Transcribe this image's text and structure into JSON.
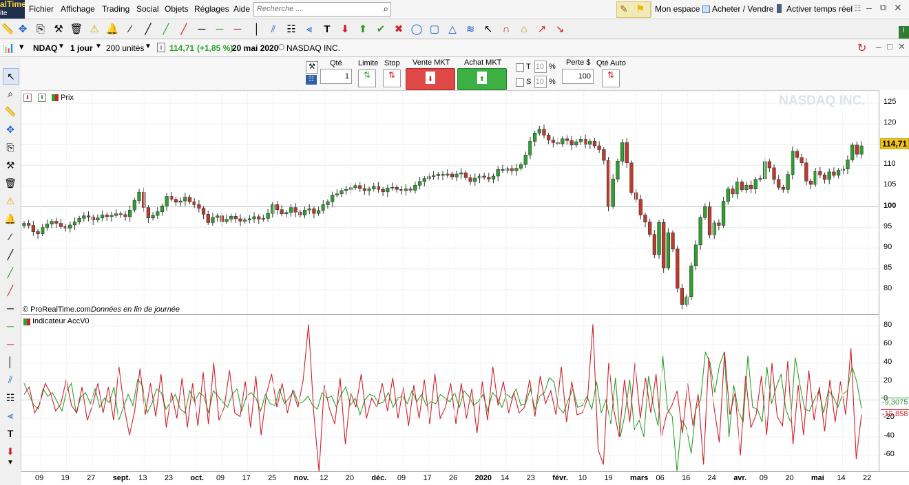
{
  "app": {
    "logo_line1": "alTime",
    "logo_line2": "ite"
  },
  "menu": [
    "Fichier",
    "Affichage",
    "Trading",
    "Social",
    "Objets",
    "Réglages",
    "Aide"
  ],
  "search": {
    "placeholder": "Recherche ..."
  },
  "top_buttons": {
    "mon_espace": "Mon espace",
    "acheter_vendre": "Acheter / Vendre",
    "activer": "Activer temps réel"
  },
  "window": {
    "ticker": "NDAQ",
    "interval": "1 jour",
    "units": "200 unités",
    "price": "114,71",
    "change": "(+1,85 %)",
    "date": "20 mai 2020",
    "name": "NASDAQ INC."
  },
  "order": {
    "qte_label": "Qté",
    "qte_value": "1",
    "limite_label": "Limite",
    "stop_label": "Stop",
    "vente_label": "Vente MKT",
    "achat_label": "Achat MKT",
    "t_label": "T",
    "s_label": "S",
    "t_value": "10",
    "s_value": "10",
    "pct": "%",
    "perte_label": "Perte $",
    "perte_value": "100",
    "qte_auto_label": "Qté Auto"
  },
  "price_panel": {
    "legend": "Prix",
    "watermark": "NASDAQ INC.",
    "footer_source": "© ProRealTime.com",
    "footer_note": "Données en fin de journée",
    "last_tag": "114,71"
  },
  "indicator_panel": {
    "legend": "Indicateur AccV0",
    "tag_green": "-9,3075",
    "tag_red": "-15,858"
  },
  "colors": {
    "up": "#2ea02e",
    "down": "#c0392b",
    "green_line": "#2ea02e",
    "red_line": "#d0202a",
    "last_tag_bg": "#f0c419"
  },
  "chart_data": [
    {
      "type": "candlestick",
      "title": "NASDAQ INC.",
      "ylim": [
        74,
        128
      ],
      "yticks": [
        80,
        85,
        90,
        95,
        100,
        105,
        110,
        115,
        120,
        125
      ],
      "x_tick_labels": [
        "09",
        "19",
        "27",
        "sept.",
        "13",
        "23",
        "oct.",
        "09",
        "17",
        "25",
        "nov.",
        "12",
        "20",
        "déc.",
        "09",
        "17",
        "26",
        "2020",
        "14",
        "23",
        "févr.",
        "10",
        "19",
        "mars",
        "06",
        "16",
        "24",
        "avr.",
        "09",
        "20",
        "mai",
        "14",
        "22"
      ],
      "close_path": [
        96,
        95.5,
        94,
        93.5,
        95,
        95.8,
        96.5,
        96,
        95.2,
        94.8,
        95.6,
        96.3,
        97.2,
        97.8,
        97.5,
        96.8,
        97.3,
        98,
        97.6,
        97.9,
        98.3,
        98.1,
        97.6,
        99.2,
        101.5,
        103.5,
        99.8,
        97.3,
        97.9,
        98.8,
        100.2,
        102.5,
        101.8,
        101.1,
        101.4,
        102.3,
        101.2,
        100.5,
        99.6,
        98.2,
        96.2,
        97.4,
        97.8,
        96.4,
        97.0,
        97.7,
        97.1,
        96.5,
        96.8,
        97.1,
        97.6,
        97.0,
        97.2,
        98.4,
        100.5,
        99.3,
        98.3,
        98.6,
        99.8,
        98.7,
        98.0,
        99.2,
        99.5,
        98.4,
        99.1,
        100.5,
        101.2,
        102.8,
        103.1,
        103.9,
        104.2,
        104.6,
        105.1,
        104.4,
        103.9,
        104.3,
        104.9,
        104.2,
        103.6,
        104.5,
        104.7,
        104.2,
        103.9,
        104.3,
        104.0,
        105.2,
        106.1,
        106.8,
        107.3,
        107.5,
        107.8,
        107.6,
        107.9,
        107.2,
        107.9,
        108.2,
        107.0,
        106.1,
        106.9,
        107.4,
        107.1,
        106.7,
        107.4,
        109.0,
        108.8,
        109.2,
        108.7,
        109.3,
        110.2,
        112.5,
        115.8,
        117.8,
        118.7,
        117.3,
        116.1,
        115.5,
        115.2,
        116.4,
        116.0,
        114.9,
        115.7,
        116.3,
        115.1,
        115.8,
        114.7,
        113.8,
        111.2,
        100.1,
        106.7,
        111.0,
        115.5,
        110.6,
        103.4,
        101.8,
        98.0,
        96.3,
        93.3,
        88.4,
        96.2,
        85.2,
        93.7,
        89.8,
        80.3,
        76.4,
        78.2,
        85.7,
        90.8,
        97.4,
        100.0,
        93.2,
        96.1,
        95.5,
        101.3,
        104.3,
        103.1,
        106.0,
        104.1,
        105.2,
        104.3,
        106.6,
        106.8,
        110.9,
        109.4,
        106.6,
        104.7,
        104.2,
        107.8,
        113.4,
        111.9,
        110.6,
        106.2,
        105.4,
        108.5,
        107.7,
        106.6,
        108.4,
        107.6,
        108.8,
        109.1,
        111.3,
        114.9,
        112.7,
        114.7
      ]
    },
    {
      "type": "line",
      "title": "Indicateur AccV0",
      "ylim": [
        -78,
        92
      ],
      "yticks": [
        80,
        60,
        40,
        20,
        0,
        -20,
        -40,
        -60
      ],
      "series": [
        {
          "name": "green",
          "values": [
            18,
            6,
            -5,
            -10,
            12,
            4,
            8,
            -2,
            -12,
            10,
            18,
            -14,
            3,
            8,
            -4,
            12,
            -8,
            2,
            -3,
            14,
            -22,
            -8,
            6,
            -6,
            22,
            16,
            -14,
            -4,
            12,
            8,
            -10,
            -2,
            6,
            -10,
            -14,
            10,
            -2,
            8,
            4,
            -14,
            10,
            4,
            -2,
            -8,
            6,
            12,
            -12,
            4,
            8,
            2,
            -12,
            6,
            -4,
            -6,
            12,
            -4,
            2,
            10,
            -4,
            -2,
            4,
            -6,
            -10,
            8,
            2,
            4,
            -8,
            6,
            14,
            -6,
            2,
            -16,
            0,
            6,
            4,
            -4,
            -2,
            8,
            -8,
            2,
            4,
            -4,
            10,
            -2,
            6,
            -6,
            -2,
            -4,
            6,
            2,
            -2,
            8,
            -8,
            10,
            4,
            -6,
            -2,
            6,
            -12,
            8,
            2,
            -8,
            6,
            2,
            12,
            -6,
            -4,
            12,
            -10,
            4,
            8,
            24,
            20,
            -8,
            -14,
            0,
            12,
            -8,
            -6,
            4,
            -10,
            20,
            -14,
            0,
            -26,
            24,
            -40,
            -16,
            22,
            -32,
            -22,
            -40,
            26,
            -6,
            -28,
            48,
            -10,
            -18,
            -78,
            -22,
            -30,
            -58,
            -10,
            0,
            52,
            40,
            8,
            38,
            52,
            -40,
            16,
            -12,
            -24,
            48,
            -8,
            -10,
            -24,
            36,
            -4,
            14,
            28,
            -10,
            -24,
            46,
            16,
            -10,
            -12,
            0,
            10,
            -14,
            10,
            4,
            -8,
            6,
            10,
            36,
            20,
            -9
          ]
        },
        {
          "name": "red",
          "values": [
            6,
            14,
            -14,
            -4,
            18,
            8,
            -12,
            -4,
            22,
            -6,
            -14,
            14,
            -22,
            -6,
            18,
            -14,
            14,
            -22,
            36,
            -8,
            -38,
            -12,
            34,
            -16,
            18,
            -18,
            28,
            -30,
            8,
            -20,
            24,
            -30,
            18,
            -28,
            30,
            -26,
            40,
            -22,
            -8,
            32,
            -14,
            -18,
            20,
            -30,
            26,
            -38,
            6,
            28,
            -8,
            18,
            -14,
            10,
            -8,
            22,
            82,
            -14,
            -78,
            16,
            -10,
            -26,
            24,
            -48,
            8,
            -8,
            28,
            -20,
            2,
            -8,
            18,
            -12,
            24,
            -20,
            14,
            -28,
            16,
            -20,
            22,
            -26,
            28,
            -20,
            -8,
            18,
            -26,
            18,
            -20,
            12,
            -36,
            20,
            -22,
            36,
            -6,
            20,
            -14,
            8,
            -14,
            -8,
            22,
            -18,
            26,
            -4,
            10,
            -16,
            36,
            -24,
            20,
            -16,
            -14,
            2,
            82,
            -54,
            -70,
            40,
            -12,
            -40,
            22,
            -24,
            40,
            -20,
            24,
            -14,
            28,
            -40,
            -16,
            -6,
            10,
            -36,
            18,
            -28,
            6,
            -70,
            46,
            -8,
            -46,
            52,
            -16,
            8,
            -60,
            26,
            -30,
            -16,
            26,
            -38,
            40,
            -18,
            -28,
            42,
            -48,
            16,
            -38,
            32,
            -22,
            14,
            -34,
            22,
            -24,
            20,
            -16,
            56,
            -64,
            -16
          ]
        }
      ]
    }
  ]
}
